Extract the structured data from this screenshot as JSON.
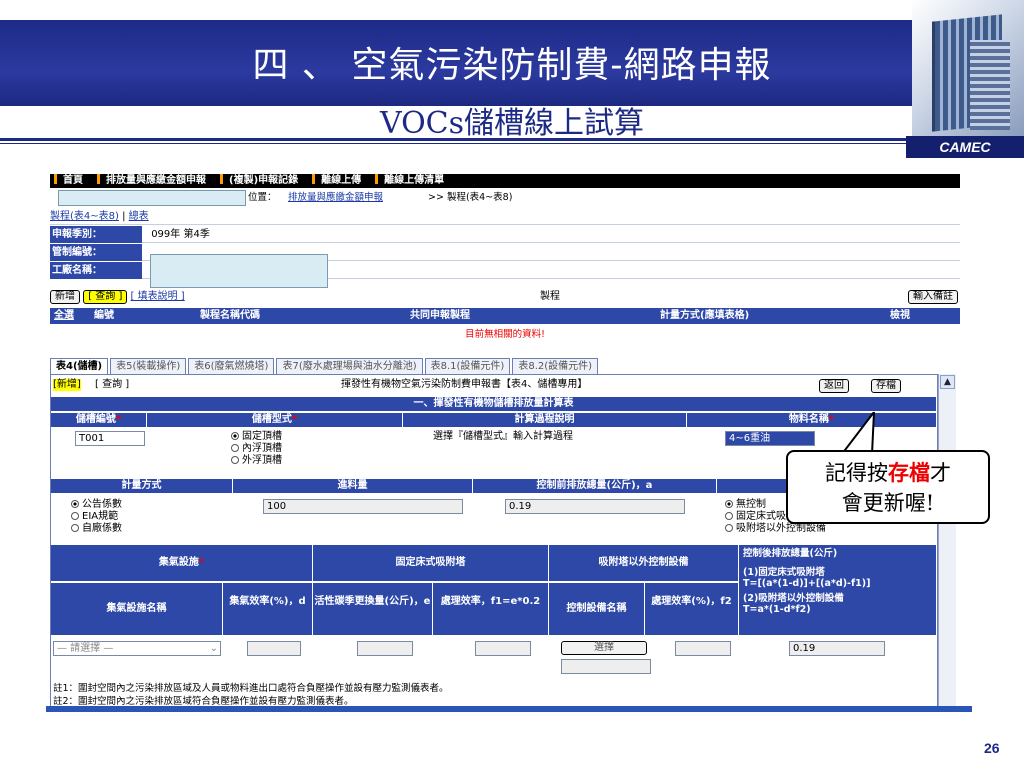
{
  "slide": {
    "title_line1": "四 、 空氣污染防制費-網路申報",
    "title_line2": "VOCs儲槽線上試算",
    "logo_text": "CAMEC",
    "page_number": "26",
    "callout_pre": "記得按",
    "callout_highlight": "存檔",
    "callout_post": "才",
    "callout_line2": "會更新喔!"
  },
  "app": {
    "nav": [
      "首頁",
      "排放量與應繳金額申報",
      "(複製)申報記錄",
      "離線上傳",
      "離線上傳清單"
    ],
    "location_label": "位置：",
    "location_link": "排放量與應繳金額申報",
    "location_rest": " >> 製程(表4~表8)",
    "sub_link1": "製程(表4~表8)",
    "sub_sep": " | ",
    "sub_link2": "總表",
    "field_period_label": "申報季別：",
    "field_period_value": "099年 第4季",
    "field_control_label": "管制編號：",
    "field_factory_label": "工廠名稱：",
    "btn_new": "新增",
    "btn_query": "[ 查詢 ]",
    "link_help": "[ 填表說明 ]",
    "process_label": "製程",
    "btn_remark": "輸入備註",
    "list_headers": {
      "select_all": "全選",
      "edit": "編號",
      "name": "製程名稱代碼",
      "common": "共同申報製程",
      "method": "計量方式(應填表格)",
      "review": "檢視"
    },
    "no_data": "目前無相關的資料!",
    "tabs": [
      "表4(儲槽)",
      "表5(裝載操作)",
      "表6(廢氣燃燒塔)",
      "表7(廢水處理場與油水分離池)",
      "表8.1(設備元件)",
      "表8.2(設備元件)"
    ],
    "panel": {
      "new": "[新增]",
      "query": "[ 查詢 ]",
      "title": "揮發性有機物空氣污染防制費申報書【表4、儲槽專用】",
      "back": "返回",
      "save": "存檔",
      "section": "一、揮發性有機物儲槽排放量計算表",
      "h_tank_id": "儲槽編號",
      "h_tank_type": "儲槽型式",
      "h_calc": "計算過程說明",
      "h_material": "物料名稱",
      "tank_id": "T001",
      "tank_types": [
        "固定頂槽",
        "內浮頂槽",
        "外浮頂槽"
      ],
      "calc_note": "選擇『儲槽型式』輸入計算過程",
      "material_value": "4~6重油",
      "h_method": "計量方式",
      "h_input": "進料量",
      "h_pre": "控制前排放總量(公斤)，a",
      "methods": [
        "公告係數",
        "EIA規範",
        "自廠係數"
      ],
      "input_value": "100",
      "pre_value": "0.19",
      "controls": [
        "無控制",
        "固定床式吸附塔",
        "吸附塔以外控制設備"
      ],
      "h_collect": "集氣設施",
      "h_fixed": "固定床式吸附塔",
      "h_other": "吸附塔以外控制設備",
      "h_after": "控制後排放總量(公斤)",
      "after_formula1": "(1)固定床式吸附塔",
      "after_formula1b": "T=[(a*(1-d)]+[(a*d)-f1)]",
      "after_formula2": "(2)吸附塔以外控制設備",
      "after_formula2b": "T=a*(1-d*f2)",
      "h_collect_name": "集氣設施名稱",
      "h_collect_eff": "集氣效率(%)，d",
      "h_carbon": "活性碳季更換量(公斤)，e",
      "h_eff1": "處理效率，f1=e*0.2",
      "h_ctrl_name": "控制設備名稱",
      "h_eff2": "處理效率(%)，f2",
      "select_placeholder": "— 請選擇 —",
      "pick_btn": "選擇",
      "after_value": "0.19",
      "note1": "註1：圍封空間內之污染排放區域及人員或物料進出口處符合負壓操作並設有壓力監測儀表者。",
      "note2": "註2：圍封空間內之污染排放區域符合負壓操作並設有壓力監測儀表者。"
    }
  },
  "colors": {
    "navy": "#1c2a86",
    "header_blue": "#2e48a8",
    "highlight": "#e00000"
  }
}
